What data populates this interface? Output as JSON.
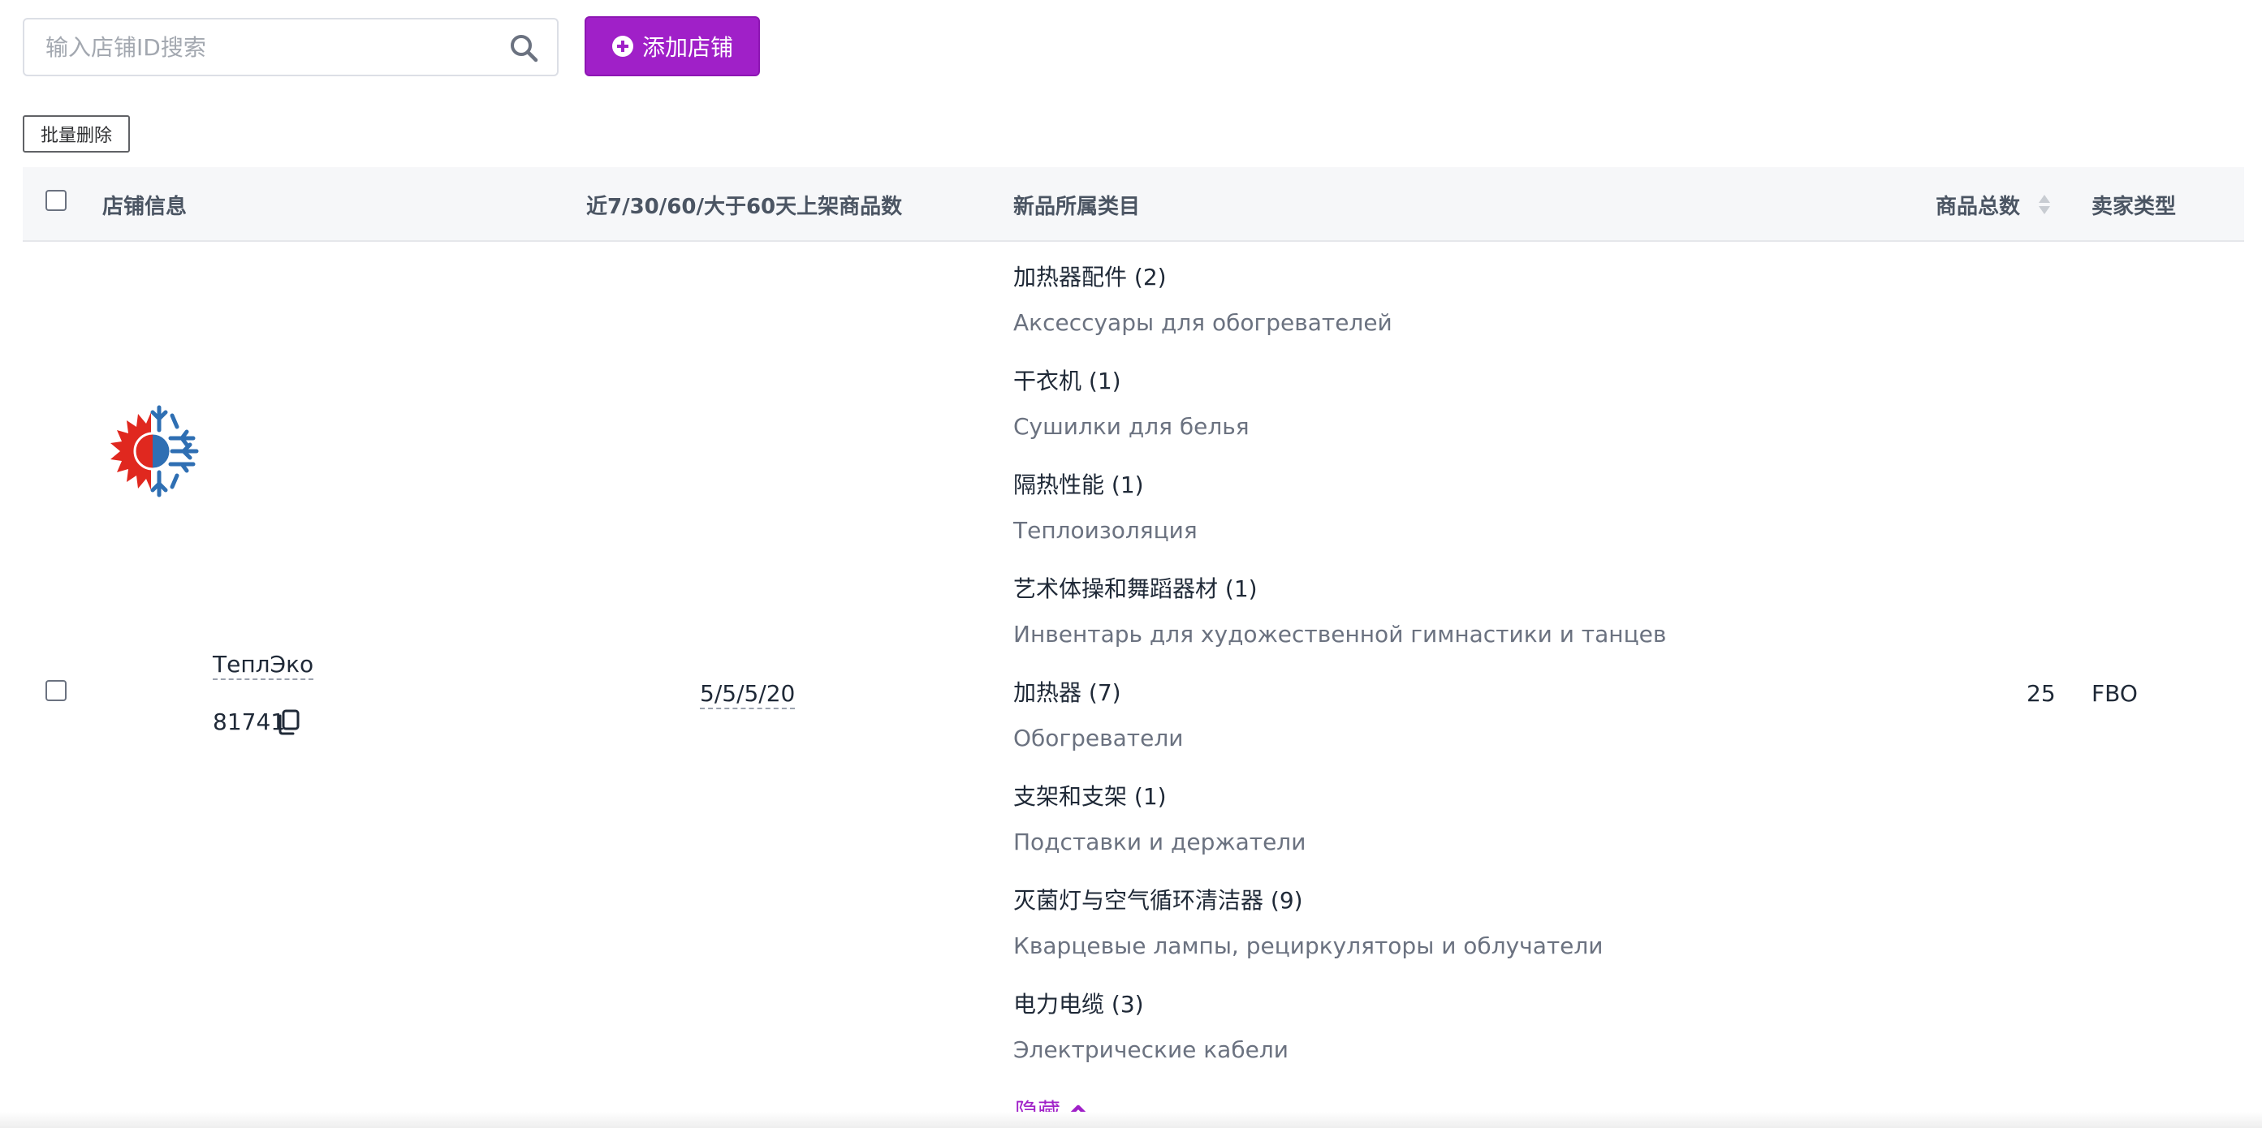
{
  "toolbar": {
    "search_placeholder": "输入店铺ID搜索",
    "add_shop_label": "添加店铺",
    "batch_delete_label": "批量删除",
    "accent_color": "#a020c8"
  },
  "table": {
    "headers": {
      "shop_info": "店铺信息",
      "listed_counts": "近7/30/60/大于60天上架商品数",
      "categories": "新品所属类目",
      "total_products": "商品总数",
      "seller_type": "卖家类型"
    },
    "rows": [
      {
        "shop_name": "ТеплЭко",
        "shop_id": "81741",
        "listed_counts": "5/5/5/20",
        "categories": [
          {
            "zh": "加热器配件 (2)",
            "ru": "Аксессуары для обогревателей"
          },
          {
            "zh": "干衣机 (1)",
            "ru": "Сушилки для белья"
          },
          {
            "zh": "隔热性能 (1)",
            "ru": "Теплоизоляция"
          },
          {
            "zh": "艺术体操和舞蹈器材 (1)",
            "ru": "Инвентарь для художественной гимнастики и танцев"
          },
          {
            "zh": "加热器 (7)",
            "ru": "Обогреватели"
          },
          {
            "zh": "支架和支架 (1)",
            "ru": "Подставки и держатели"
          },
          {
            "zh": "灭菌灯与空气循环清洁器 (9)",
            "ru": "Кварцевые лампы, рециркуляторы и облучатели"
          },
          {
            "zh": "电力电缆 (3)",
            "ru": "Электрические кабели"
          }
        ],
        "hide_label": "隐藏",
        "total_products": "25",
        "seller_type": "FBO"
      }
    ]
  },
  "icons": {
    "search": "search-icon",
    "add": "plus-circle-icon",
    "sort": "sort-icon",
    "copy": "copy-icon",
    "collapse": "chevron-up-icon",
    "logo": "sun-snowflake-logo"
  }
}
